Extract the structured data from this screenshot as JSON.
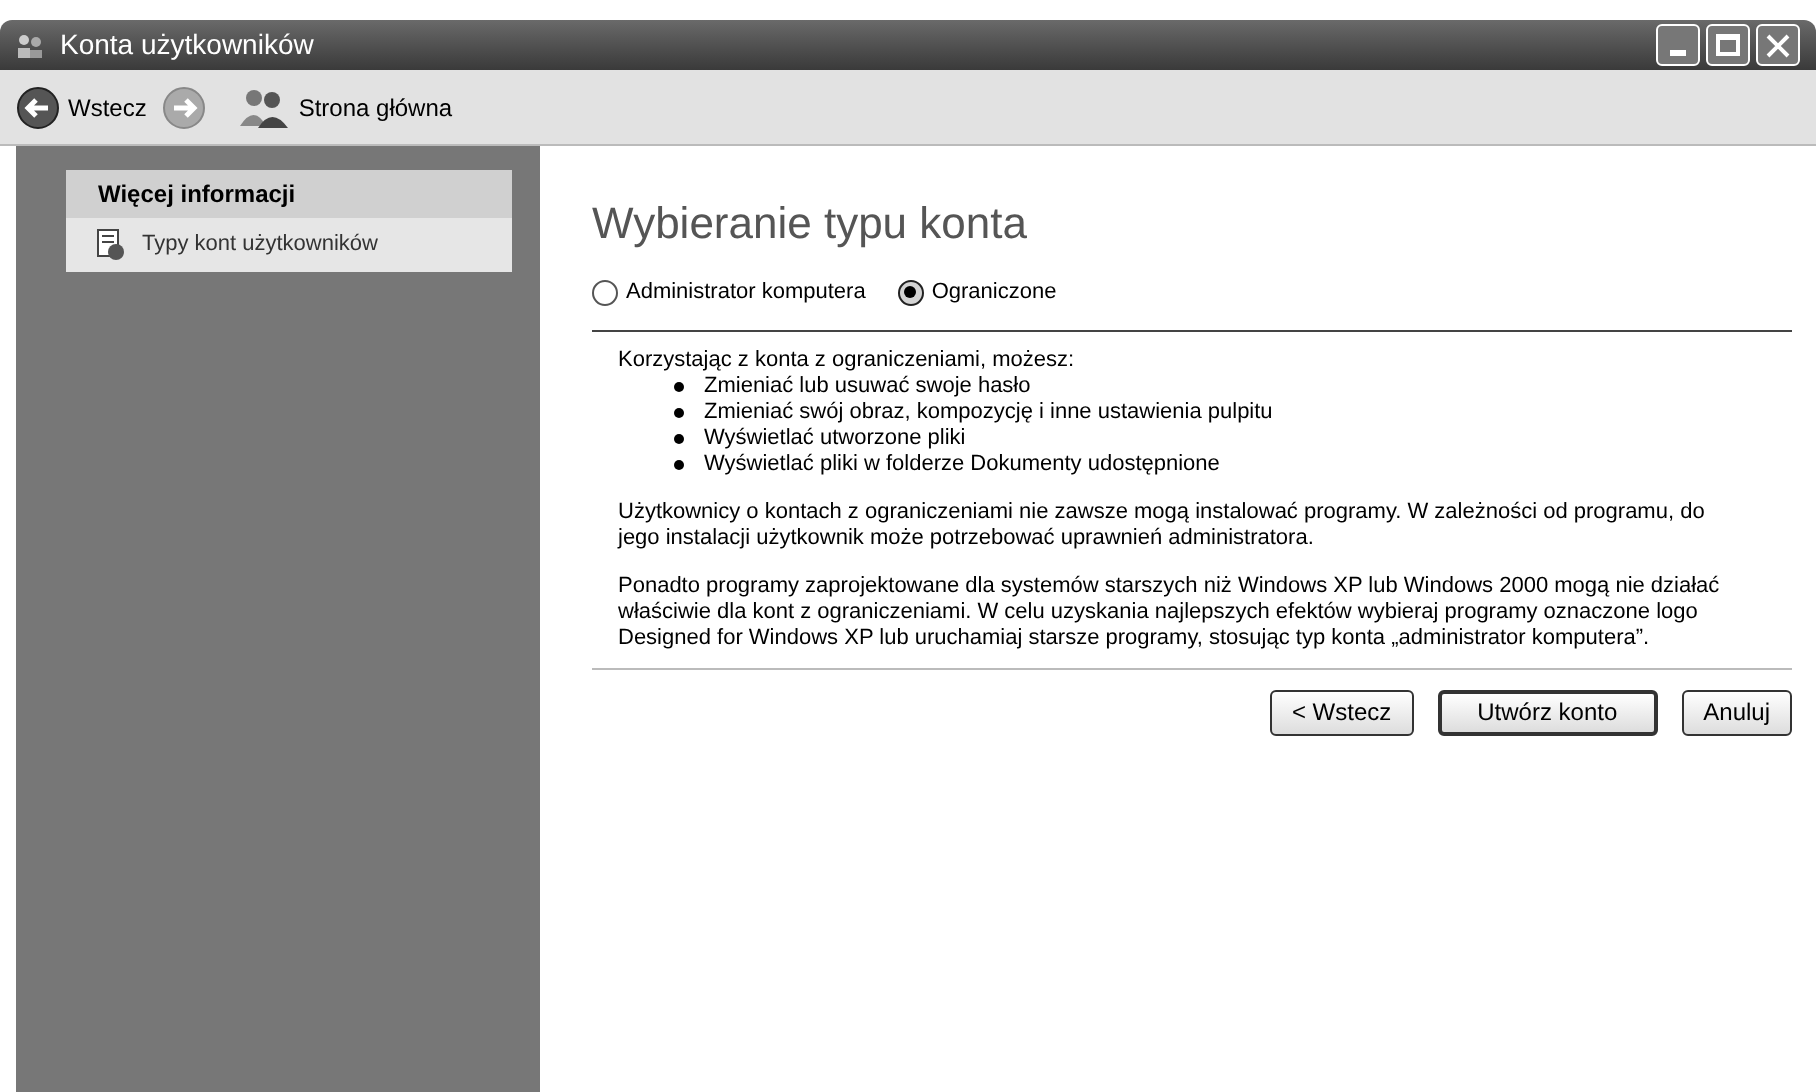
{
  "window": {
    "title": "Konta użytkowników"
  },
  "toolbar": {
    "back": "Wstecz",
    "home": "Strona główna"
  },
  "sidebar": {
    "heading": "Więcej informacji",
    "items": [
      "Typy kont użytkowników"
    ]
  },
  "main": {
    "title": "Wybieranie typu konta",
    "options": [
      {
        "label": "Administrator komputera",
        "selected": false
      },
      {
        "label": "Ograniczone",
        "selected": true
      }
    ],
    "intro": "Korzystając z konta z ograniczeniami, możesz:",
    "bullets": [
      "Zmieniać lub usuwać swoje hasło",
      "Zmieniać swój obraz, kompozycję i inne ustawienia pulpitu",
      "Wyświetlać utworzone pliki",
      "Wyświetlać pliki w folderze Dokumenty udostępnione"
    ],
    "paragraphs": [
      "Użytkownicy o kontach z ograniczeniami nie zawsze mogą instalować programy. W zależności od programu, do jego instalacji użytkownik może potrzebować uprawnień administratora.",
      "Ponadto programy zaprojektowane dla systemów starszych niż Windows XP lub Windows 2000 mogą nie działać właściwie dla kont z ograniczeniami. W celu uzyskania najlepszych efektów wybieraj programy oznaczone logo Designed for Windows XP lub uruchamiaj starsze programy, stosując typ konta „administrator komputera”."
    ],
    "buttons": [
      "< Wstecz",
      "Utwórz konto",
      "Anuluj"
    ]
  }
}
